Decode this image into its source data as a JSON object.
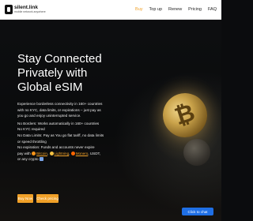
{
  "brand": {
    "title": "silent.link",
    "subtitle": "mobile network anywhere"
  },
  "nav": {
    "items": [
      {
        "label": "Buy",
        "active": true
      },
      {
        "label": "Top up",
        "active": false
      },
      {
        "label": "Renew",
        "active": false
      },
      {
        "label": "Pricing",
        "active": false
      },
      {
        "label": "FAQ",
        "active": false
      }
    ]
  },
  "hero": {
    "headline_line1": "Stay Connected",
    "headline_line2": "Privately with",
    "headline_line3": "Global eSIM",
    "desc_line1": "Experience borderless connectivity in 160+ countries",
    "desc_line2": "with no KYC, data limits, or expirations – just pay as",
    "desc_line3": "you go and enjoy uninterrupted service.",
    "feature1": "No Borders: Works automatically in 160+ countries",
    "feature2": "No KYC required",
    "feature3": "No Data Limits: Pay as You go flat tariff, no data limits",
    "feature3b": "or speed throttling",
    "feature4": "No expiration: Funds and accounts never expire",
    "pay_with": "pay with",
    "crypto": {
      "bitcoin": "Bitcoin",
      "lightning": "Lightning",
      "monero": "Monero",
      "usdt": "USDT,",
      "tail": "or any crypto"
    }
  },
  "buttons": {
    "buy": "Buy Now",
    "pricing": "Check pricing"
  },
  "chat": {
    "label": "Click to chat"
  },
  "colors": {
    "accent": "#f0a028",
    "chat": "#1f6fe5",
    "background": "#0b0c0e"
  }
}
